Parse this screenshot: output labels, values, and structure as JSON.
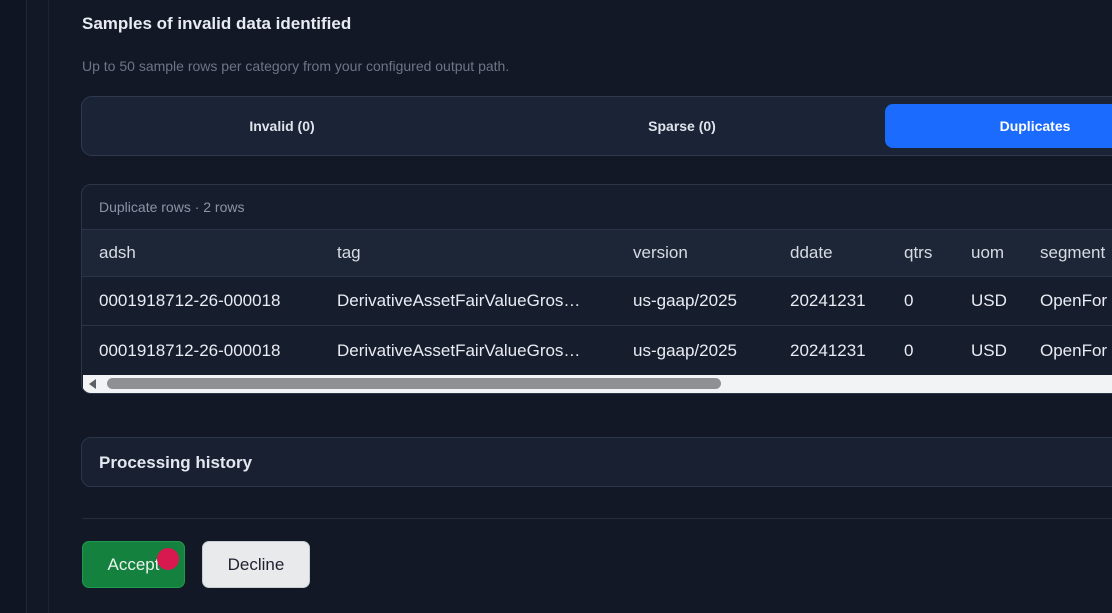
{
  "samples": {
    "title": "Samples of invalid data identified",
    "subtitle": "Up to 50 sample rows per category from your configured output path."
  },
  "tabs": [
    {
      "label": "Invalid (0)",
      "active": false
    },
    {
      "label": "Sparse (0)",
      "active": false
    },
    {
      "label": "Duplicates",
      "active": true
    }
  ],
  "table": {
    "caption": "Duplicate rows · 2 rows",
    "columns": [
      "adsh",
      "tag",
      "version",
      "ddate",
      "qtrs",
      "uom",
      "segment"
    ],
    "rows": [
      {
        "adsh": "0001918712-26-000018",
        "tag": "DerivativeAssetFairValueGros…",
        "version": "us-gaap/2025",
        "ddate": "20241231",
        "qtrs": "0",
        "uom": "USD",
        "segment": "OpenFor"
      },
      {
        "adsh": "0001918712-26-000018",
        "tag": "DerivativeAssetFairValueGros…",
        "version": "us-gaap/2025",
        "ddate": "20241231",
        "qtrs": "0",
        "uom": "USD",
        "segment": "OpenFor"
      }
    ]
  },
  "history": {
    "label": "Processing history"
  },
  "actions": {
    "accept_label": "Accept",
    "decline_label": "Decline"
  },
  "colors": {
    "background": "#121826",
    "active_tab": "#1c6bff",
    "accept": "#14813e",
    "decline": "#e9eaec",
    "cursor": "#d8194f"
  }
}
